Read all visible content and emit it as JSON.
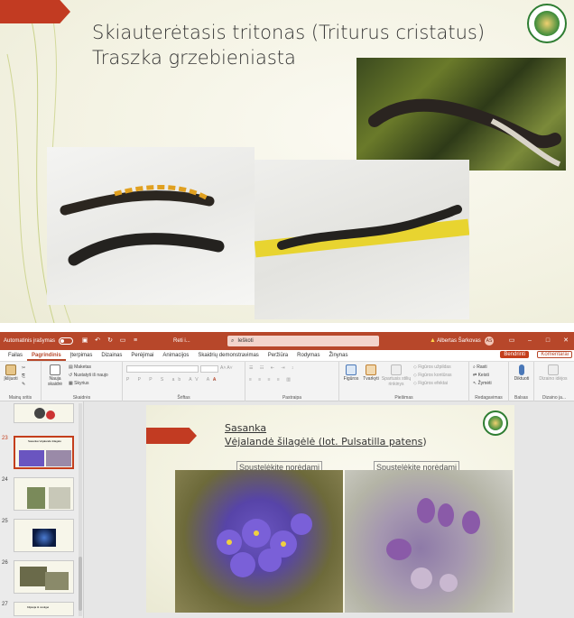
{
  "top_slide": {
    "title_line1": "Skiauterėtasis tritonas (Triturus cristatus)",
    "title_line2": "Traszka grzebieniasta"
  },
  "titlebar": {
    "autosave_label": "Automatinis įrašymas",
    "doc_name": "Reti i...",
    "search_placeholder": "Ieškoti",
    "user_name": "Albertas Šarkovas",
    "user_initials": "AS"
  },
  "tabs": [
    {
      "label": "Failas"
    },
    {
      "label": "Pagrindinis"
    },
    {
      "label": "Įterpimas"
    },
    {
      "label": "Dizainas"
    },
    {
      "label": "Perėjimai"
    },
    {
      "label": "Animacijos"
    },
    {
      "label": "Skaidrių demonstravimas"
    },
    {
      "label": "Peržiūra"
    },
    {
      "label": "Rodymas"
    },
    {
      "label": "Žinynas"
    }
  ],
  "share_label": "Bendrinti",
  "comments_label": "Komentarai",
  "ribbon": {
    "paste": "Įklijuoti",
    "clipboard_group": "Mainų sritis",
    "new_slide": "Nauja skaidrė",
    "layout": "Maketas",
    "reset": "Nustatyti iš naujo",
    "section": "Skyrius",
    "slides_group": "Skaidrės",
    "font_group": "Šriftas",
    "paragraph_group": "Pastraipa",
    "shapes": "Figūros",
    "arrange": "Tvarkyti",
    "quick_styles": "Spartusis stilių rinkinys",
    "shape_fill": "Figūros užpildas",
    "shape_outline": "Figūros kontūras",
    "shape_effects": "Figūros efektai",
    "drawing_group": "Piešimas",
    "find": "Rasti",
    "replace": "Keisti",
    "select": "Žymėti",
    "editing_group": "Redagavimas",
    "dictate": "Diktuoti",
    "voice_group": "Balsas",
    "designer": "Dizaino idėjos",
    "designer_group": "Dizaino ja..."
  },
  "thumbnails": [
    {
      "num": "23",
      "caption": "Sasanka Vėjalandė šilagėlė"
    },
    {
      "num": "24",
      "caption": ""
    },
    {
      "num": "25",
      "caption": ""
    },
    {
      "num": "26",
      "caption": ""
    },
    {
      "num": "27",
      "caption": "Klijavija iš uviulgei"
    }
  ],
  "slide": {
    "title_line1": "Sasanka",
    "title_line2_a": "Vėjalandė šilagėlė (lot. ",
    "title_line2_b": "Pulsatilla patens",
    "title_line2_c": ")",
    "placeholder_left": "Spustelėkite norėdami",
    "placeholder_right": "Spustelėkite norėdami"
  }
}
